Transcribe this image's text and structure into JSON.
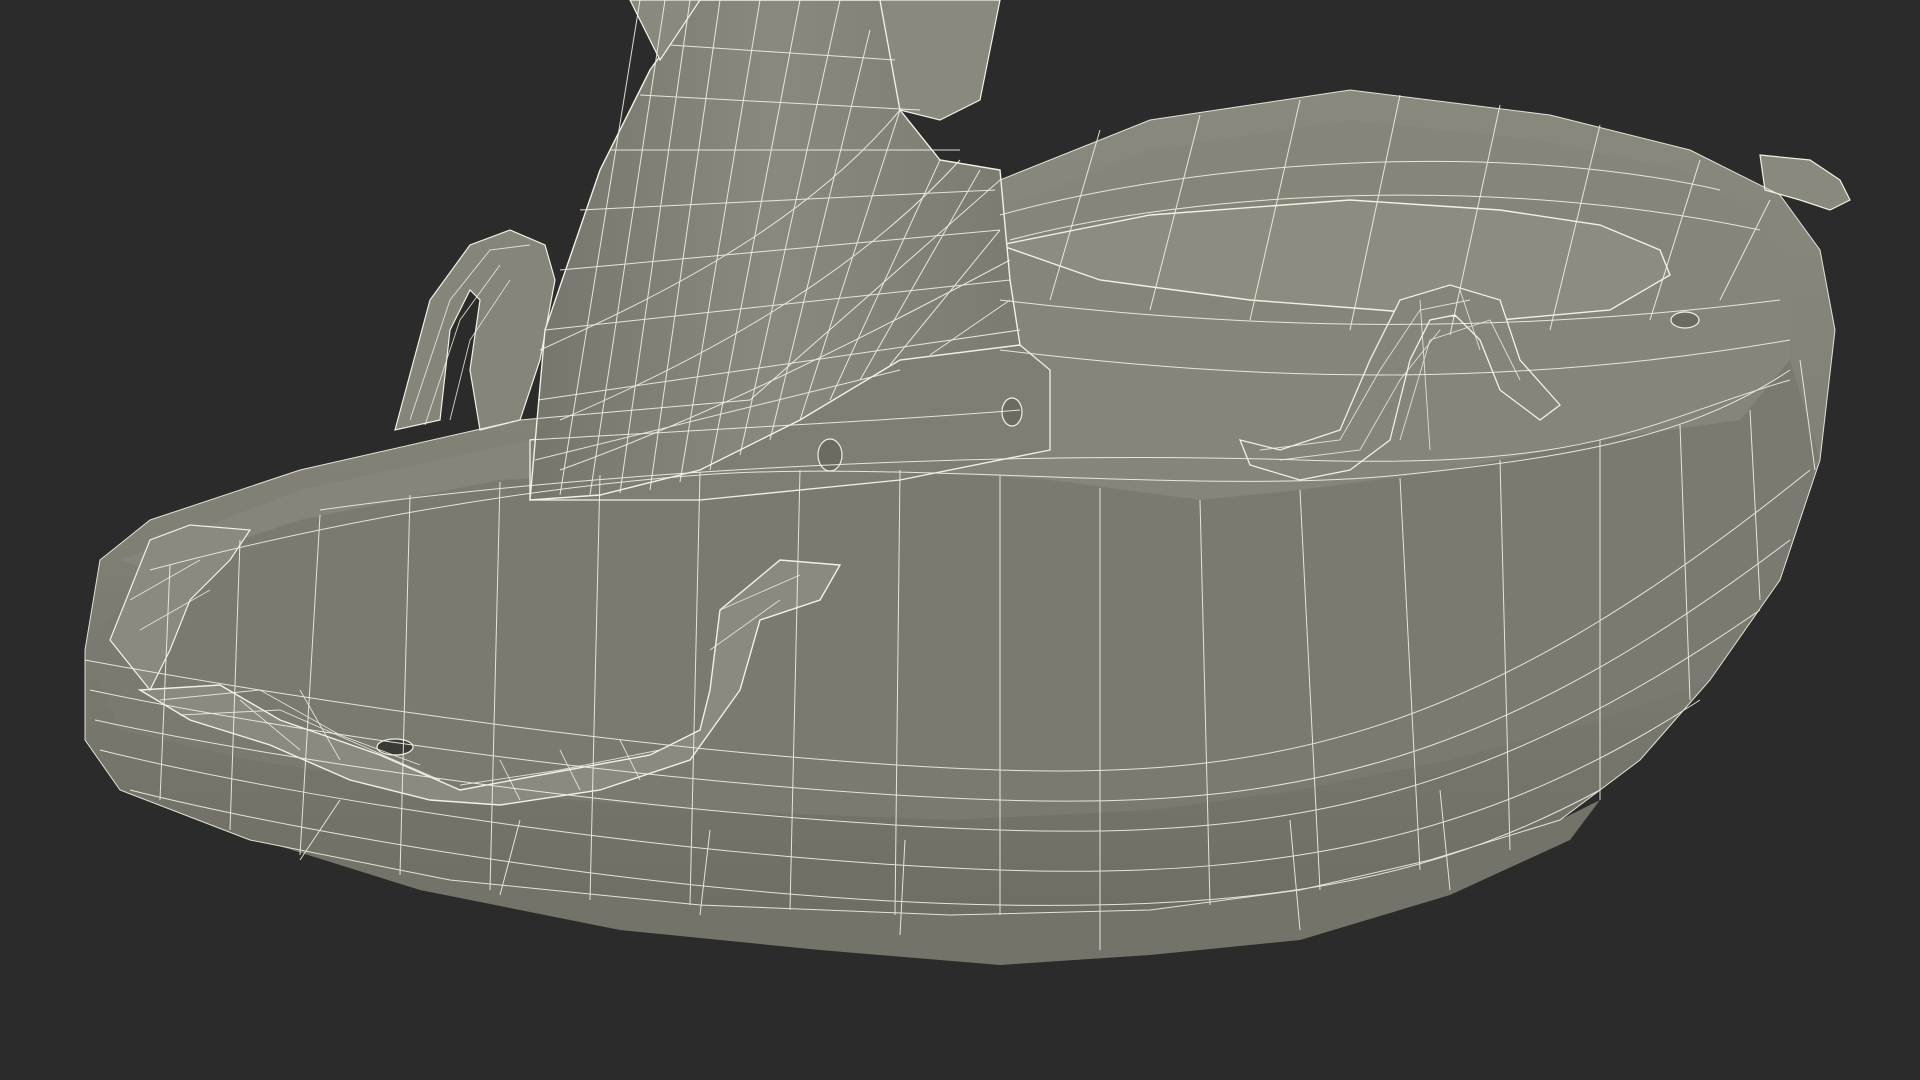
{
  "scene": {
    "background_color": "#2b2b2b",
    "surface_color": "#807f74",
    "surface_shadow_color": "#6e6d63",
    "surface_light_color": "#908f84",
    "wire_color": "#f3f1e4"
  }
}
